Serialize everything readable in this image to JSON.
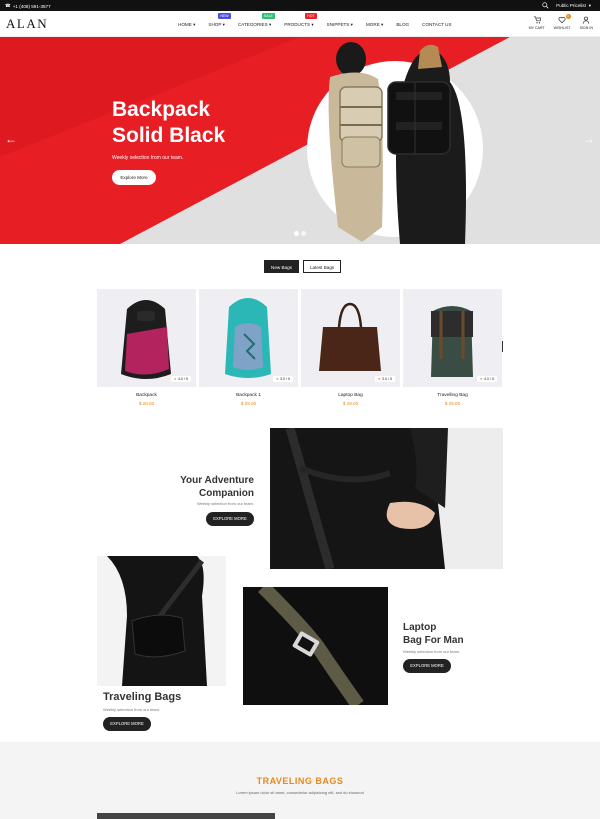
{
  "topbar": {
    "phone": "+1 (408) 591-3577",
    "currency": "Public Pricelist"
  },
  "header": {
    "logo": "ALAN",
    "nav": [
      {
        "label": "HOME",
        "caret": "▾",
        "badge": ""
      },
      {
        "label": "SHOP",
        "caret": "▾",
        "badge": "NEW",
        "badge_color": "#4b4ee0"
      },
      {
        "label": "CATEGORIES",
        "caret": "▾",
        "badge": "SALE",
        "badge_color": "#2fbf71"
      },
      {
        "label": "PRODUCTS",
        "caret": "▾",
        "badge": "HOT",
        "badge_color": "#e8232a"
      },
      {
        "label": "SNIPPETS",
        "caret": "▾",
        "badge": ""
      },
      {
        "label": "MORE",
        "caret": "▾",
        "badge": ""
      },
      {
        "label": "BLOG",
        "caret": "",
        "badge": ""
      },
      {
        "label": "CONTACT US",
        "caret": "",
        "badge": ""
      }
    ],
    "icons": [
      {
        "name": "cart-icon",
        "label": "MY CART"
      },
      {
        "name": "heart-icon",
        "label": "WISHLIST"
      },
      {
        "name": "user-icon",
        "label": "SIGN IN"
      }
    ],
    "wishlist_count": "0"
  },
  "hero": {
    "title_line1": "Backpack",
    "title_line2": "Solid Black",
    "subtitle": "Weekly selection from our team.",
    "button": "Explore More",
    "slide_count": 2,
    "active_slide": 1
  },
  "tabs": [
    "New Bags",
    "Latest Bags"
  ],
  "products": [
    {
      "name": "Backpack",
      "price": "$ 28.00",
      "rating": "4.0 / 5"
    },
    {
      "name": "Backpack 1",
      "price": "$ 28.00",
      "rating": "3.0 / 5"
    },
    {
      "name": "Laptop Bag",
      "price": "$ 28.00",
      "rating": "3.0 / 5"
    },
    {
      "name": "Travelling Bag",
      "price": "$ 28.00",
      "rating": "4.0 / 5"
    }
  ],
  "adventure": {
    "title_line1": "Your Adventure",
    "title_line2": "Companion",
    "subtitle": "Weekly selection from our team.",
    "button": "EXPLORE MORE"
  },
  "traveling": {
    "title": "Traveling Bags",
    "subtitle": "Weekly selection from our team.",
    "button": "EXPLORE MORE"
  },
  "laptop": {
    "title_line1": "Laptop",
    "title_line2": "Bag For Man",
    "subtitle": "Weekly selection from our team.",
    "button": "EXPLORE MORE"
  },
  "section": {
    "title": "TRAVELING BAGS",
    "subtitle": "Lorem ipsum dolor sit amet, consectetur adipisicing elit, sed do eiusmod"
  },
  "colors": {
    "accent": "#e8891a",
    "hero_red": "#e81e25",
    "dark": "#222222"
  }
}
